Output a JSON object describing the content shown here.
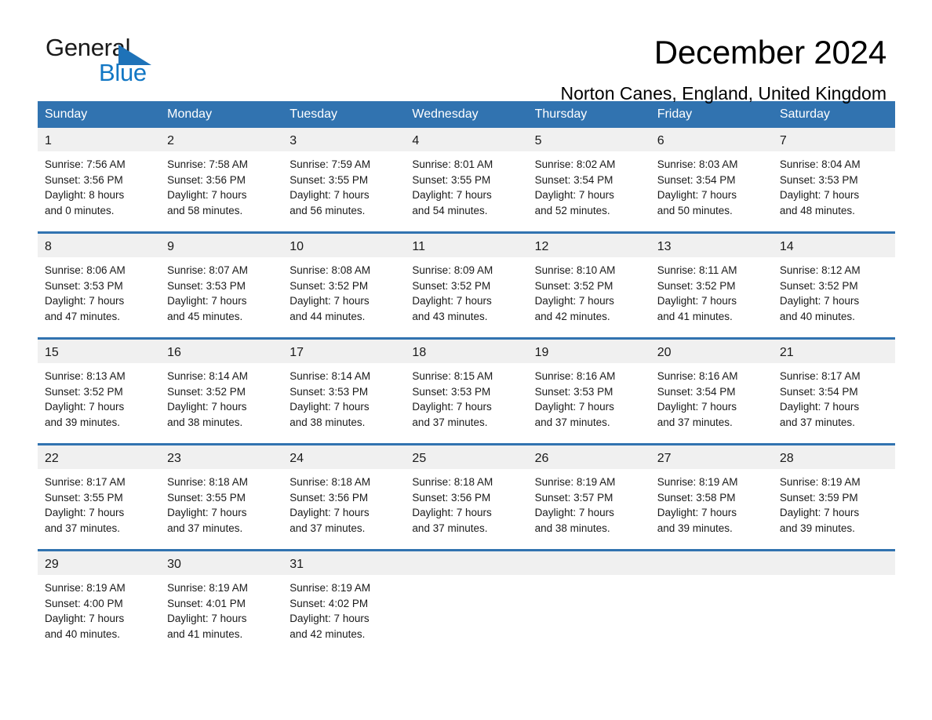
{
  "logo": {
    "word_one": "General",
    "word_two": "Blue",
    "triangle": "triangle-icon",
    "blue": "#1277c4",
    "dark": "#1a1a1a"
  },
  "header": {
    "month_title": "December 2024",
    "location": "Norton Canes, England, United Kingdom"
  },
  "theme": {
    "header_blue": "#3173b0",
    "daynum_gray": "#f0f0f0",
    "separator_blue": "#3173b0"
  },
  "weekday_headers": [
    "Sunday",
    "Monday",
    "Tuesday",
    "Wednesday",
    "Thursday",
    "Friday",
    "Saturday"
  ],
  "weeks": [
    [
      {
        "day": "1",
        "sunrise": "Sunrise: 7:56 AM",
        "sunset": "Sunset: 3:56 PM",
        "daylight_1": "Daylight: 8 hours",
        "daylight_2": "and 0 minutes."
      },
      {
        "day": "2",
        "sunrise": "Sunrise: 7:58 AM",
        "sunset": "Sunset: 3:56 PM",
        "daylight_1": "Daylight: 7 hours",
        "daylight_2": "and 58 minutes."
      },
      {
        "day": "3",
        "sunrise": "Sunrise: 7:59 AM",
        "sunset": "Sunset: 3:55 PM",
        "daylight_1": "Daylight: 7 hours",
        "daylight_2": "and 56 minutes."
      },
      {
        "day": "4",
        "sunrise": "Sunrise: 8:01 AM",
        "sunset": "Sunset: 3:55 PM",
        "daylight_1": "Daylight: 7 hours",
        "daylight_2": "and 54 minutes."
      },
      {
        "day": "5",
        "sunrise": "Sunrise: 8:02 AM",
        "sunset": "Sunset: 3:54 PM",
        "daylight_1": "Daylight: 7 hours",
        "daylight_2": "and 52 minutes."
      },
      {
        "day": "6",
        "sunrise": "Sunrise: 8:03 AM",
        "sunset": "Sunset: 3:54 PM",
        "daylight_1": "Daylight: 7 hours",
        "daylight_2": "and 50 minutes."
      },
      {
        "day": "7",
        "sunrise": "Sunrise: 8:04 AM",
        "sunset": "Sunset: 3:53 PM",
        "daylight_1": "Daylight: 7 hours",
        "daylight_2": "and 48 minutes."
      }
    ],
    [
      {
        "day": "8",
        "sunrise": "Sunrise: 8:06 AM",
        "sunset": "Sunset: 3:53 PM",
        "daylight_1": "Daylight: 7 hours",
        "daylight_2": "and 47 minutes."
      },
      {
        "day": "9",
        "sunrise": "Sunrise: 8:07 AM",
        "sunset": "Sunset: 3:53 PM",
        "daylight_1": "Daylight: 7 hours",
        "daylight_2": "and 45 minutes."
      },
      {
        "day": "10",
        "sunrise": "Sunrise: 8:08 AM",
        "sunset": "Sunset: 3:52 PM",
        "daylight_1": "Daylight: 7 hours",
        "daylight_2": "and 44 minutes."
      },
      {
        "day": "11",
        "sunrise": "Sunrise: 8:09 AM",
        "sunset": "Sunset: 3:52 PM",
        "daylight_1": "Daylight: 7 hours",
        "daylight_2": "and 43 minutes."
      },
      {
        "day": "12",
        "sunrise": "Sunrise: 8:10 AM",
        "sunset": "Sunset: 3:52 PM",
        "daylight_1": "Daylight: 7 hours",
        "daylight_2": "and 42 minutes."
      },
      {
        "day": "13",
        "sunrise": "Sunrise: 8:11 AM",
        "sunset": "Sunset: 3:52 PM",
        "daylight_1": "Daylight: 7 hours",
        "daylight_2": "and 41 minutes."
      },
      {
        "day": "14",
        "sunrise": "Sunrise: 8:12 AM",
        "sunset": "Sunset: 3:52 PM",
        "daylight_1": "Daylight: 7 hours",
        "daylight_2": "and 40 minutes."
      }
    ],
    [
      {
        "day": "15",
        "sunrise": "Sunrise: 8:13 AM",
        "sunset": "Sunset: 3:52 PM",
        "daylight_1": "Daylight: 7 hours",
        "daylight_2": "and 39 minutes."
      },
      {
        "day": "16",
        "sunrise": "Sunrise: 8:14 AM",
        "sunset": "Sunset: 3:52 PM",
        "daylight_1": "Daylight: 7 hours",
        "daylight_2": "and 38 minutes."
      },
      {
        "day": "17",
        "sunrise": "Sunrise: 8:14 AM",
        "sunset": "Sunset: 3:53 PM",
        "daylight_1": "Daylight: 7 hours",
        "daylight_2": "and 38 minutes."
      },
      {
        "day": "18",
        "sunrise": "Sunrise: 8:15 AM",
        "sunset": "Sunset: 3:53 PM",
        "daylight_1": "Daylight: 7 hours",
        "daylight_2": "and 37 minutes."
      },
      {
        "day": "19",
        "sunrise": "Sunrise: 8:16 AM",
        "sunset": "Sunset: 3:53 PM",
        "daylight_1": "Daylight: 7 hours",
        "daylight_2": "and 37 minutes."
      },
      {
        "day": "20",
        "sunrise": "Sunrise: 8:16 AM",
        "sunset": "Sunset: 3:54 PM",
        "daylight_1": "Daylight: 7 hours",
        "daylight_2": "and 37 minutes."
      },
      {
        "day": "21",
        "sunrise": "Sunrise: 8:17 AM",
        "sunset": "Sunset: 3:54 PM",
        "daylight_1": "Daylight: 7 hours",
        "daylight_2": "and 37 minutes."
      }
    ],
    [
      {
        "day": "22",
        "sunrise": "Sunrise: 8:17 AM",
        "sunset": "Sunset: 3:55 PM",
        "daylight_1": "Daylight: 7 hours",
        "daylight_2": "and 37 minutes."
      },
      {
        "day": "23",
        "sunrise": "Sunrise: 8:18 AM",
        "sunset": "Sunset: 3:55 PM",
        "daylight_1": "Daylight: 7 hours",
        "daylight_2": "and 37 minutes."
      },
      {
        "day": "24",
        "sunrise": "Sunrise: 8:18 AM",
        "sunset": "Sunset: 3:56 PM",
        "daylight_1": "Daylight: 7 hours",
        "daylight_2": "and 37 minutes."
      },
      {
        "day": "25",
        "sunrise": "Sunrise: 8:18 AM",
        "sunset": "Sunset: 3:56 PM",
        "daylight_1": "Daylight: 7 hours",
        "daylight_2": "and 37 minutes."
      },
      {
        "day": "26",
        "sunrise": "Sunrise: 8:19 AM",
        "sunset": "Sunset: 3:57 PM",
        "daylight_1": "Daylight: 7 hours",
        "daylight_2": "and 38 minutes."
      },
      {
        "day": "27",
        "sunrise": "Sunrise: 8:19 AM",
        "sunset": "Sunset: 3:58 PM",
        "daylight_1": "Daylight: 7 hours",
        "daylight_2": "and 39 minutes."
      },
      {
        "day": "28",
        "sunrise": "Sunrise: 8:19 AM",
        "sunset": "Sunset: 3:59 PM",
        "daylight_1": "Daylight: 7 hours",
        "daylight_2": "and 39 minutes."
      }
    ],
    [
      {
        "day": "29",
        "sunrise": "Sunrise: 8:19 AM",
        "sunset": "Sunset: 4:00 PM",
        "daylight_1": "Daylight: 7 hours",
        "daylight_2": "and 40 minutes."
      },
      {
        "day": "30",
        "sunrise": "Sunrise: 8:19 AM",
        "sunset": "Sunset: 4:01 PM",
        "daylight_1": "Daylight: 7 hours",
        "daylight_2": "and 41 minutes."
      },
      {
        "day": "31",
        "sunrise": "Sunrise: 8:19 AM",
        "sunset": "Sunset: 4:02 PM",
        "daylight_1": "Daylight: 7 hours",
        "daylight_2": "and 42 minutes."
      },
      {
        "day": "",
        "sunrise": "",
        "sunset": "",
        "daylight_1": "",
        "daylight_2": ""
      },
      {
        "day": "",
        "sunrise": "",
        "sunset": "",
        "daylight_1": "",
        "daylight_2": ""
      },
      {
        "day": "",
        "sunrise": "",
        "sunset": "",
        "daylight_1": "",
        "daylight_2": ""
      },
      {
        "day": "",
        "sunrise": "",
        "sunset": "",
        "daylight_1": "",
        "daylight_2": ""
      }
    ]
  ]
}
